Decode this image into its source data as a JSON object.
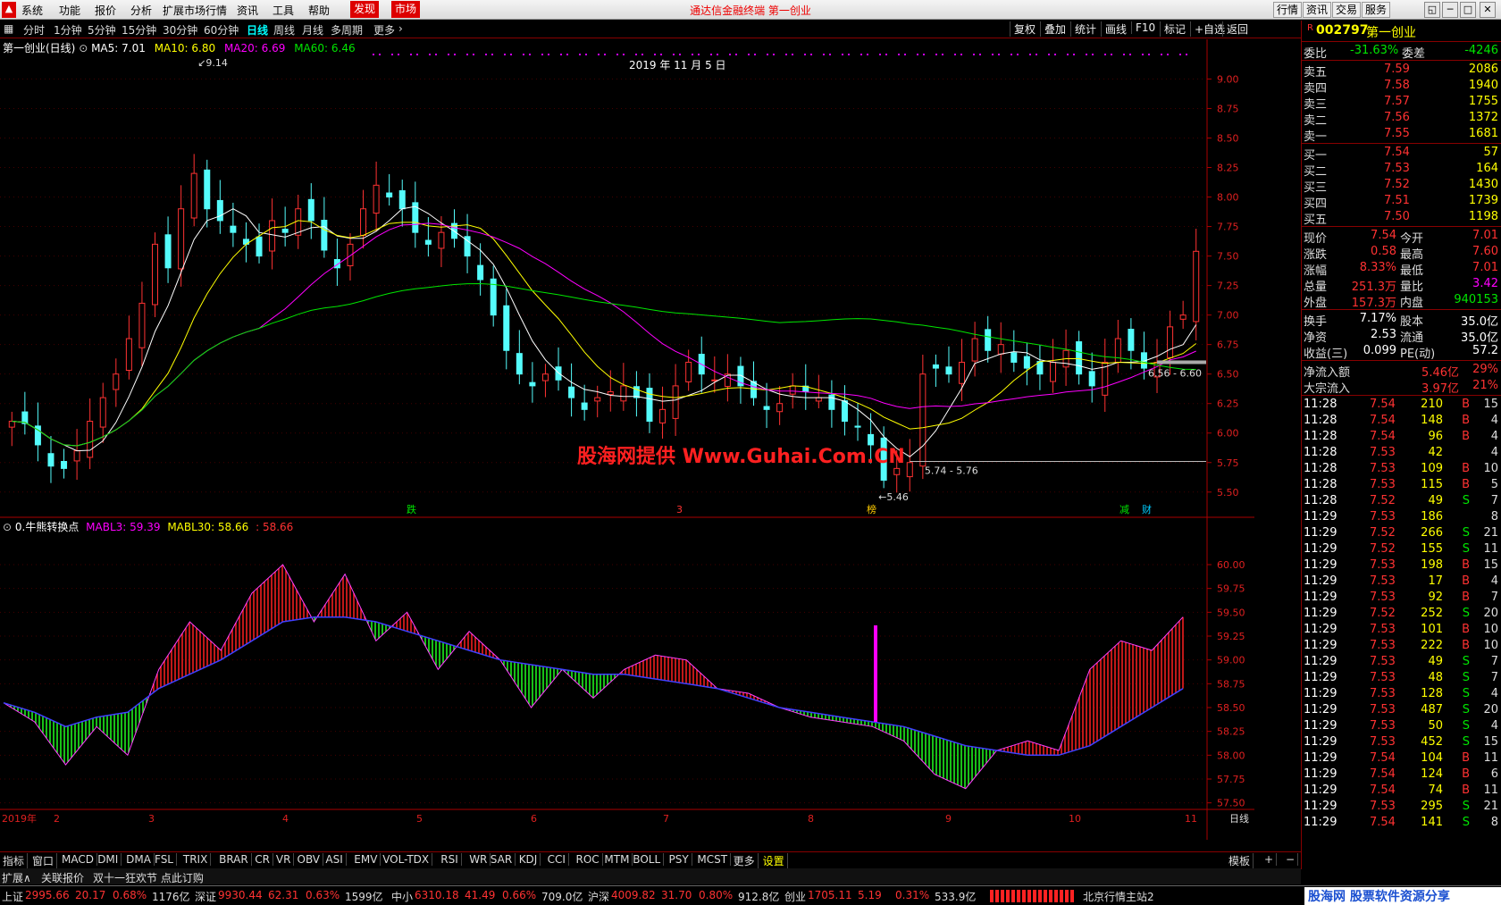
{
  "menu": {
    "items": [
      "系统",
      "功能",
      "报价",
      "分析",
      "扩展市场行情",
      "资讯",
      "工具",
      "帮助"
    ],
    "highlight": [
      "发现",
      "市场"
    ],
    "title": "通达信金融终端 第一创业",
    "right_buttons": [
      "行情",
      "资讯",
      "交易",
      "服务"
    ]
  },
  "toolbar": {
    "periods": [
      "分时",
      "1分钟",
      "5分钟",
      "15分钟",
      "30分钟",
      "60分钟",
      "日线",
      "周线",
      "月线",
      "多周期",
      "更多"
    ],
    "active": "日线",
    "tools": [
      "复权",
      "叠加",
      "统计",
      "画线",
      "F10",
      "标记",
      "+自选",
      "返回"
    ]
  },
  "main_chart": {
    "legend": {
      "name": "第一创业(日线)",
      "ma5": "MA5: 7.01",
      "ma10": "MA10: 6.80",
      "ma20": "MA20: 6.69",
      "ma60": "MA60: 6.46"
    },
    "date_label": "2019 年 11 月 5 日",
    "annotations": {
      "high": "9.14",
      "low": "5.46",
      "range1": "5.74 - 5.76",
      "range2": "6.56 - 6.60"
    },
    "events": [
      "跌",
      "3",
      "榜",
      "减",
      "财"
    ],
    "colors": {
      "up": "#ff3232",
      "down": "#54fcfc",
      "ma5": "#ffffff",
      "ma10": "#ffff00",
      "ma20": "#ff00ff",
      "ma60": "#00e600"
    }
  },
  "chart_data": [
    {
      "type": "candlestick",
      "title": "第一创业(日线)",
      "ylim": [
        5.4,
        9.2
      ],
      "yticks": [
        "9.00",
        "8.75",
        "8.50",
        "8.25",
        "8.00",
        "7.75",
        "7.50",
        "7.25",
        "7.00",
        "6.75",
        "6.50",
        "6.25",
        "6.00",
        "5.75",
        "5.50"
      ],
      "xticks": [
        "2019年",
        "2",
        "3",
        "4",
        "5",
        "6",
        "7",
        "8",
        "9",
        "10",
        "11"
      ],
      "series": [
        {
          "name": "close",
          "values": [
            6.1,
            6.08,
            5.9,
            5.72,
            5.7,
            5.85,
            6.1,
            6.3,
            6.5,
            6.8,
            7.1,
            7.6,
            7.4,
            7.9,
            8.2,
            7.9,
            7.8,
            7.7,
            7.6,
            7.5,
            7.8,
            7.7,
            7.9,
            7.8,
            7.55,
            7.4,
            7.6,
            7.9,
            8.1,
            8.0,
            7.9,
            7.7,
            7.6,
            7.7,
            7.65,
            7.5,
            7.3,
            7.0,
            6.7,
            6.5,
            6.4,
            6.5,
            6.45,
            6.3,
            6.2,
            6.3,
            6.35,
            6.4,
            6.3,
            6.1,
            6.2,
            6.4,
            6.6,
            6.5,
            6.45,
            6.5,
            6.4,
            6.3,
            6.2,
            6.25,
            6.4,
            6.35,
            6.3,
            6.2,
            6.1,
            6.05,
            5.9,
            5.6,
            5.7,
            5.75,
            6.5,
            6.55,
            6.5,
            6.6,
            6.8,
            6.7,
            6.75,
            6.6,
            6.55,
            6.5,
            6.6,
            6.7,
            6.5,
            6.4,
            6.6,
            6.8,
            6.7,
            6.55,
            6.6,
            6.9,
            7.0,
            7.54
          ]
        },
        {
          "name": "MA5",
          "values": [
            7.01
          ]
        },
        {
          "name": "MA10",
          "values": [
            6.8
          ]
        },
        {
          "name": "MA20",
          "values": [
            6.69
          ]
        },
        {
          "name": "MA60",
          "values": [
            6.46
          ]
        }
      ]
    },
    {
      "type": "area",
      "title": "0.牛熊转换点",
      "ylim": [
        57.3,
        60.3
      ],
      "yticks": [
        "60.00",
        "59.75",
        "59.50",
        "59.25",
        "59.00",
        "58.75",
        "58.50",
        "58.25",
        "58.00",
        "57.75",
        "57.50"
      ],
      "series": [
        {
          "name": "MABL3",
          "values": [
            58.55,
            58.35,
            57.9,
            58.3,
            58.0,
            58.9,
            59.4,
            59.1,
            59.7,
            60.0,
            59.4,
            59.9,
            59.2,
            59.5,
            58.9,
            59.3,
            59.0,
            58.5,
            58.9,
            58.6,
            58.9,
            59.05,
            59.0,
            58.7,
            58.65,
            58.5,
            58.4,
            58.35,
            58.3,
            58.15,
            57.8,
            57.65,
            58.05,
            58.15,
            58.05,
            58.9,
            59.2,
            59.1,
            59.45
          ]
        },
        {
          "name": "MABL30",
          "values": [
            58.55,
            58.45,
            58.3,
            58.4,
            58.45,
            58.7,
            58.85,
            59.0,
            59.2,
            59.4,
            59.45,
            59.45,
            59.4,
            59.3,
            59.2,
            59.1,
            59.0,
            58.95,
            58.9,
            58.85,
            58.85,
            58.8,
            58.75,
            58.7,
            58.6,
            58.5,
            58.45,
            58.4,
            58.35,
            58.3,
            58.2,
            58.1,
            58.05,
            58.0,
            58.0,
            58.1,
            58.3,
            58.5,
            58.7
          ]
        }
      ],
      "legend": {
        "name": "0.牛熊转换点",
        "mabl3": "MABL3: 59.39",
        "mabl30": "MABL30: 58.66",
        "extra": ": 58.66"
      }
    }
  ],
  "quote": {
    "code": "002797",
    "name": "第一创业",
    "weibi": {
      "label": "委比",
      "value": "-31.63%",
      "label2": "委差",
      "value2": "-4246"
    },
    "asks": [
      {
        "label": "卖五",
        "price": "7.59",
        "vol": "2086"
      },
      {
        "label": "卖四",
        "price": "7.58",
        "vol": "1940"
      },
      {
        "label": "卖三",
        "price": "7.57",
        "vol": "1755"
      },
      {
        "label": "卖二",
        "price": "7.56",
        "vol": "1372"
      },
      {
        "label": "卖一",
        "price": "7.55",
        "vol": "1681"
      }
    ],
    "bids": [
      {
        "label": "买一",
        "price": "7.54",
        "vol": "57"
      },
      {
        "label": "买二",
        "price": "7.53",
        "vol": "164"
      },
      {
        "label": "买三",
        "price": "7.52",
        "vol": "1430"
      },
      {
        "label": "买四",
        "price": "7.51",
        "vol": "1739"
      },
      {
        "label": "买五",
        "price": "7.50",
        "vol": "1198"
      }
    ],
    "stats": [
      {
        "l1": "现价",
        "v1": "7.54",
        "l2": "今开",
        "v2": "7.01"
      },
      {
        "l1": "涨跌",
        "v1": "0.58",
        "l2": "最高",
        "v2": "7.60"
      },
      {
        "l1": "涨幅",
        "v1": "8.33%",
        "l2": "最低",
        "v2": "7.01"
      },
      {
        "l1": "总量",
        "v1": "251.3万",
        "l2": "量比",
        "v2": "3.42"
      },
      {
        "l1": "外盘",
        "v1": "157.3万",
        "l2": "内盘",
        "v2": "940153"
      }
    ],
    "stats2": [
      {
        "l1": "换手",
        "v1": "7.17%",
        "l2": "股本",
        "v2": "35.0亿"
      },
      {
        "l1": "净资",
        "v1": "2.53",
        "l2": "流通",
        "v2": "35.0亿"
      },
      {
        "l1": "收益(三)",
        "v1": "0.099",
        "l2": "PE(动)",
        "v2": "57.2"
      }
    ],
    "flows": [
      {
        "label": "净流入额",
        "value": "5.46亿",
        "pct": "29%"
      },
      {
        "label": "大宗流入",
        "value": "3.97亿",
        "pct": "21%"
      }
    ],
    "ticks": [
      [
        "11:28",
        "7.54",
        "210",
        "B",
        "15"
      ],
      [
        "11:28",
        "7.54",
        "148",
        "B",
        "4"
      ],
      [
        "11:28",
        "7.54",
        "96",
        "B",
        "4"
      ],
      [
        "11:28",
        "7.53",
        "42",
        "",
        "4"
      ],
      [
        "11:28",
        "7.53",
        "109",
        "B",
        "10"
      ],
      [
        "11:28",
        "7.53",
        "115",
        "B",
        "5"
      ],
      [
        "11:28",
        "7.52",
        "49",
        "S",
        "7"
      ],
      [
        "11:29",
        "7.53",
        "186",
        "",
        "8"
      ],
      [
        "11:29",
        "7.52",
        "266",
        "S",
        "21"
      ],
      [
        "11:29",
        "7.52",
        "155",
        "S",
        "11"
      ],
      [
        "11:29",
        "7.53",
        "198",
        "B",
        "15"
      ],
      [
        "11:29",
        "7.53",
        "17",
        "B",
        "4"
      ],
      [
        "11:29",
        "7.53",
        "92",
        "B",
        "7"
      ],
      [
        "11:29",
        "7.52",
        "252",
        "S",
        "20"
      ],
      [
        "11:29",
        "7.53",
        "101",
        "B",
        "10"
      ],
      [
        "11:29",
        "7.53",
        "222",
        "B",
        "10"
      ],
      [
        "11:29",
        "7.53",
        "49",
        "S",
        "7"
      ],
      [
        "11:29",
        "7.53",
        "48",
        "S",
        "7"
      ],
      [
        "11:29",
        "7.53",
        "128",
        "S",
        "4"
      ],
      [
        "11:29",
        "7.53",
        "487",
        "S",
        "20"
      ],
      [
        "11:29",
        "7.53",
        "50",
        "S",
        "4"
      ],
      [
        "11:29",
        "7.53",
        "452",
        "S",
        "15"
      ],
      [
        "11:29",
        "7.54",
        "104",
        "B",
        "11"
      ],
      [
        "11:29",
        "7.54",
        "124",
        "B",
        "6"
      ],
      [
        "11:29",
        "7.54",
        "74",
        "B",
        "11"
      ],
      [
        "11:29",
        "7.53",
        "295",
        "S",
        "21"
      ],
      [
        "11:29",
        "7.54",
        "141",
        "S",
        "8"
      ]
    ]
  },
  "tabs": {
    "indicators": [
      "指标",
      "窗口",
      "MACD",
      "DMI",
      "DMA",
      "FSL",
      "TRIX",
      "BRAR",
      "CR",
      "VR",
      "OBV",
      "ASI",
      "EMV",
      "VOL-TDX",
      "RSI",
      "WR",
      "SAR",
      "KDJ",
      "CCI",
      "ROC",
      "MTM",
      "BOLL",
      "PSY",
      "MCST",
      "更多",
      "设置"
    ],
    "right": [
      "模板",
      "+",
      "−"
    ],
    "ext": [
      "扩展∧",
      "关联报价",
      "双十一狂欢节 点此订购"
    ]
  },
  "status": [
    {
      "name": "上证",
      "price": "2995.66",
      "chg": "20.17",
      "pct": "0.68%",
      "amt": "1176亿"
    },
    {
      "name": "深证",
      "price": "9930.44",
      "chg": "62.31",
      "pct": "0.63%",
      "amt": "1599亿"
    },
    {
      "name": "中小",
      "price": "6310.18",
      "chg": "41.49",
      "pct": "0.66%",
      "amt": "709.0亿"
    },
    {
      "name": "沪深",
      "price": "4009.82",
      "chg": "31.70",
      "pct": "0.80%",
      "amt": "912.8亿"
    },
    {
      "name": "创业",
      "price": "1705.11",
      "chg": "5.19",
      "pct": "0.31%",
      "amt": "533.9亿"
    }
  ],
  "status_extra": "北京行情主站2",
  "watermark": "股海网提供 Www.Guhai.Com.CN",
  "brand": "股海网 股票软件资源分享",
  "right_axis_label": "日线"
}
